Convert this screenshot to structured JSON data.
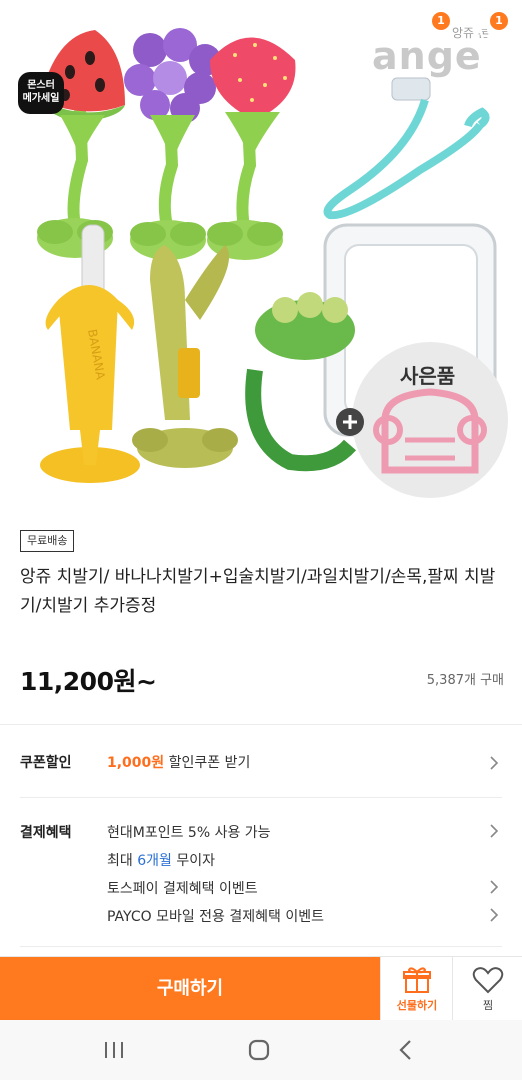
{
  "hero": {
    "mega_sale_badge": "몬스터\n메가세일",
    "brand_logo": "ange",
    "brand_header_text": "앙쥬 론",
    "cart_badge_count": "1",
    "notify_badge_count": "1",
    "gift_callout": "사은품",
    "banana_text": "BANANA"
  },
  "product": {
    "shipping_tag": "무료배송",
    "title": "앙쥬 치발기/ 바나나치발기+입술치발기/과일치발기/손목,팔찌 치발기/치발기 추가증정",
    "price": "11,200원~",
    "sold_count": "5,387개 구매"
  },
  "coupon": {
    "label": "쿠폰할인",
    "amount": "1,000원",
    "text": "할인쿠폰 받기"
  },
  "payment": {
    "label": "결제혜택",
    "line1": "현대M포인트 5% 사용 가능",
    "line2_prefix": "최대 ",
    "line2_highlight": "6개월",
    "line2_suffix": " 무이자",
    "line3": "토스페이 결제혜택 이벤트",
    "line4": "PAYCO 모바일 전용 결제혜택 이벤트"
  },
  "bottom_bar": {
    "buy_label": "구매하기",
    "gift_label": "선물하기",
    "wish_label": "찜"
  },
  "colors": {
    "accent": "#ff7a1f",
    "blue_highlight": "#2a6fd6"
  }
}
